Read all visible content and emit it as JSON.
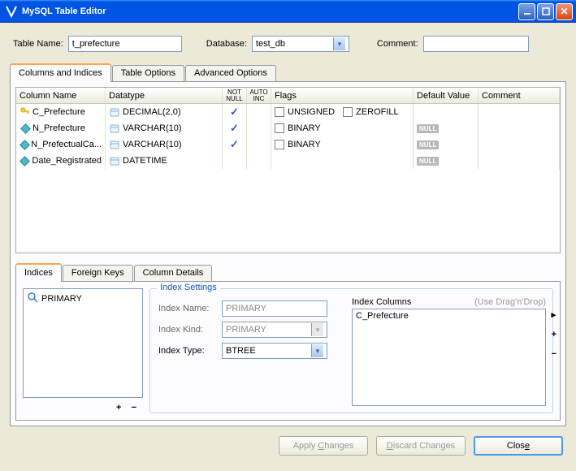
{
  "window": {
    "title": "MySQL Table Editor"
  },
  "top": {
    "table_name_label": "Table Name:",
    "table_name_value": "t_prefecture",
    "database_label": "Database:",
    "database_value": "test_db",
    "comment_label": "Comment:",
    "comment_value": ""
  },
  "main_tabs": [
    "Columns and Indices",
    "Table Options",
    "Advanced Options"
  ],
  "grid": {
    "head": {
      "name": "Column Name",
      "dtype": "Datatype",
      "nn": "NOT NULL",
      "ai": "AUTO INC",
      "flags": "Flags",
      "def": "Default Value",
      "comm": "Comment"
    },
    "rows": [
      {
        "icon": "key",
        "name": "C_Prefecture",
        "dtype": "DECIMAL(2,0)",
        "nn": true,
        "ai": false,
        "flags": [
          "UNSIGNED",
          "ZEROFILL"
        ],
        "def": "",
        "null": false
      },
      {
        "icon": "diamond",
        "name": "N_Prefecture",
        "dtype": "VARCHAR(10)",
        "nn": true,
        "ai": false,
        "flags": [
          "BINARY"
        ],
        "def": "",
        "null": true
      },
      {
        "icon": "diamond",
        "name": "N_PrefectualCa...",
        "dtype": "VARCHAR(10)",
        "nn": true,
        "ai": false,
        "flags": [
          "BINARY"
        ],
        "def": "",
        "null": true
      },
      {
        "icon": "diamond",
        "name": "Date_Registrated",
        "dtype": "DATETIME",
        "nn": false,
        "ai": false,
        "flags": [],
        "def": "",
        "null": true
      }
    ]
  },
  "sub_tabs": [
    "Indices",
    "Foreign Keys",
    "Column Details"
  ],
  "indices_list": [
    "PRIMARY"
  ],
  "index_settings": {
    "legend": "Index Settings",
    "name_label": "Index Name:",
    "name_value": "PRIMARY",
    "kind_label": "Index Kind:",
    "kind_value": "PRIMARY",
    "type_label": "Index Type:",
    "type_value": "BTREE",
    "cols_label": "Index Columns",
    "cols_hint": "(Use Drag'n'Drop)",
    "cols": [
      "C_Prefecture"
    ]
  },
  "footer": {
    "apply": "Apply Changes",
    "discard": "Discard Changes",
    "close": "Close"
  }
}
